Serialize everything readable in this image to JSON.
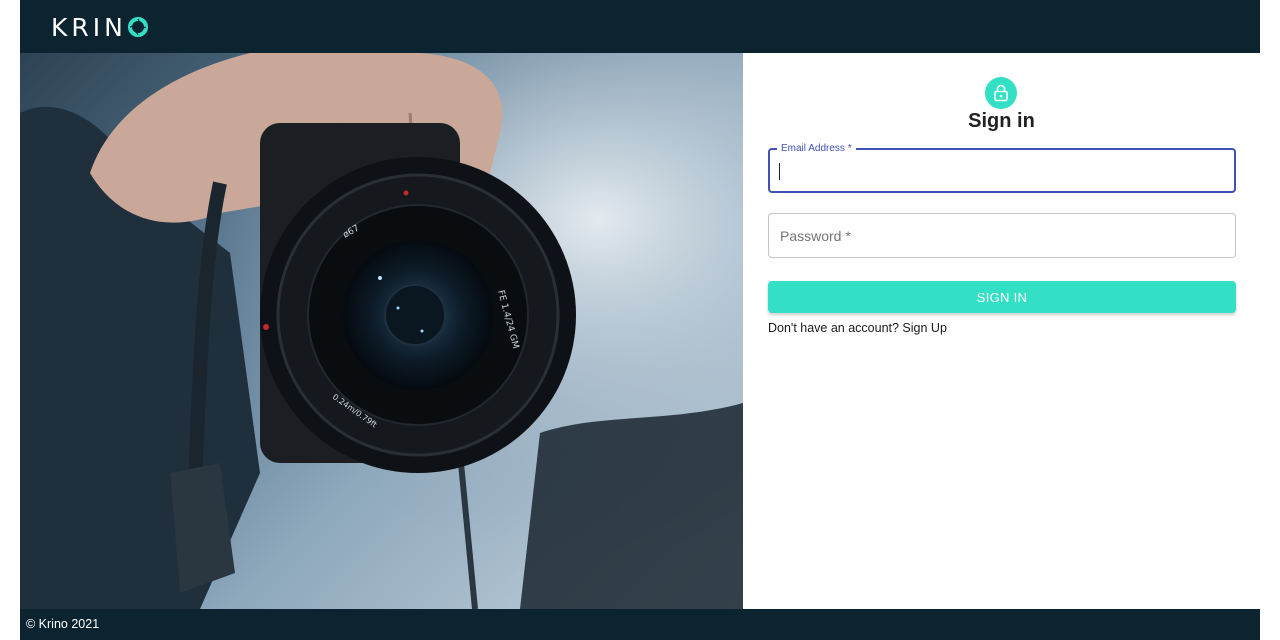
{
  "header": {
    "brand_text": "KRIN",
    "brand_logo_icon": "aperture-o-icon",
    "background": "#0b2430"
  },
  "hero": {
    "lens_text_top": "ø67",
    "lens_text_right": "FE 1.4/24 GM",
    "lens_text_bottom": "0.24m/0.79ft"
  },
  "form": {
    "avatar_icon": "lock-icon",
    "title": "Sign in",
    "email": {
      "label": "Email Address *",
      "value": ""
    },
    "password": {
      "placeholder": "Password *",
      "value": ""
    },
    "submit_label": "SIGN IN",
    "signup_link": "Don't have an account? Sign Up",
    "accent": "#33e0c5",
    "focus_color": "#3f51b5"
  },
  "footer": {
    "copyright": "© Krino 2021"
  }
}
